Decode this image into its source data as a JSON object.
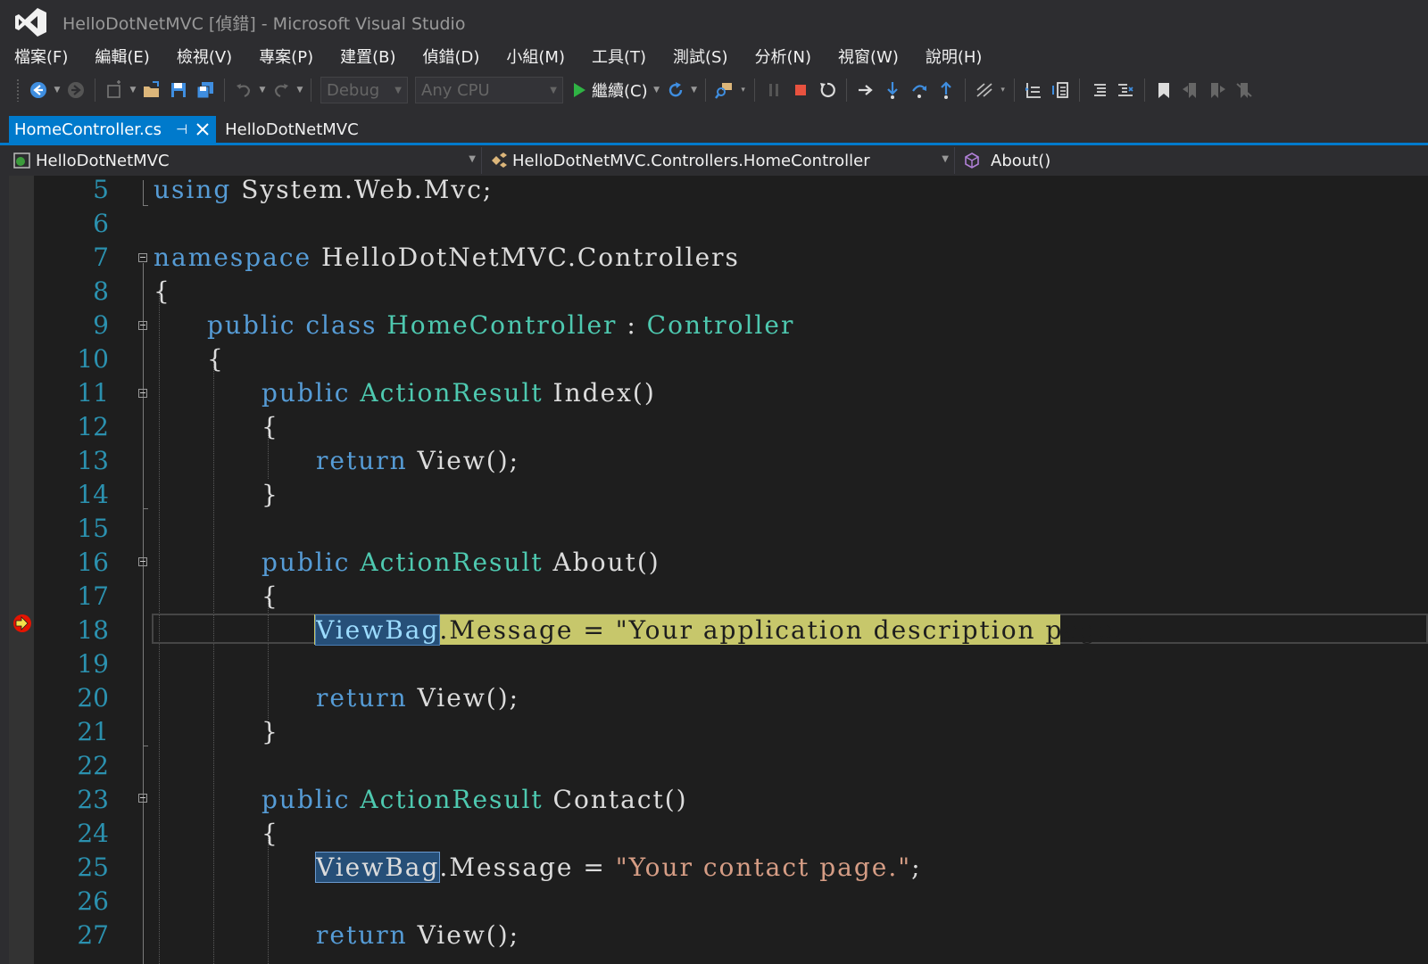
{
  "window": {
    "title": "HelloDotNetMVC [偵錯] - Microsoft Visual Studio"
  },
  "menu": {
    "items": [
      "檔案(F)",
      "編輯(E)",
      "檢視(V)",
      "專案(P)",
      "建置(B)",
      "偵錯(D)",
      "小組(M)",
      "工具(T)",
      "測試(S)",
      "分析(N)",
      "視窗(W)",
      "說明(H)"
    ]
  },
  "toolbar": {
    "configuration": "Debug",
    "platform": "Any CPU",
    "continue_label": "繼續(C)",
    "icons": [
      "back-icon",
      "forward-icon",
      "new-project-icon",
      "open-file-icon",
      "save-icon",
      "save-all-icon",
      "undo-icon",
      "redo-icon",
      "play-icon",
      "refresh-icon",
      "find-icon",
      "pause-icon",
      "stop-icon",
      "restart-icon",
      "show-next-statement-icon",
      "step-into-icon",
      "step-over-icon",
      "step-out-icon",
      "hot-reload-icon",
      "bookmark-icon"
    ]
  },
  "tabs": {
    "active": "HomeController.cs",
    "inactive": "HelloDotNetMVC"
  },
  "navbar": {
    "project": "HelloDotNetMVC",
    "class": "HelloDotNetMVC.Controllers.HomeController",
    "member": "About()"
  },
  "editor": {
    "line_numbers": [
      "5",
      "6",
      "7",
      "8",
      "9",
      "10",
      "11",
      "12",
      "13",
      "14",
      "15",
      "16",
      "17",
      "18",
      "19",
      "20",
      "21",
      "22",
      "23",
      "24",
      "25",
      "26",
      "27"
    ],
    "current_line": "18",
    "lines": {
      "l5_kw": "using",
      "l5_rest": " System.Web.Mvc;",
      "l7_kw": "namespace",
      "l7_rest": " HelloDotNetMVC.Controllers",
      "l8": "{",
      "l9_kw": "public class",
      "l9_type1": "HomeController",
      "l9_sep": " : ",
      "l9_type2": "Controller",
      "l10": "{",
      "l11_kw": "public",
      "l11_type": "ActionResult",
      "l11_rest": " Index()",
      "l12": "{",
      "l13_kw": "return",
      "l13_rest": " View();",
      "l14": "}",
      "l16_kw": "public",
      "l16_type": "ActionResult",
      "l16_rest": " About()",
      "l17": "{",
      "l18_viewbag": "ViewBag",
      "l18_rest": ".Message = \"Your application description page.\";",
      "l20_kw": "return",
      "l20_rest": " View();",
      "l21": "}",
      "l23_kw": "public",
      "l23_type": "ActionResult",
      "l23_rest": " Contact()",
      "l24": "{",
      "l25_viewbag": "ViewBag",
      "l25_mid": ".Message = ",
      "l25_str": "\"Your contact page.\"",
      "l25_end": ";",
      "l27_kw": "return",
      "l27_rest": " View();"
    }
  },
  "colors": {
    "keyword": "#569cd6",
    "type": "#4ec9b0",
    "string": "#d69d85",
    "line_number": "#2b91af",
    "accent": "#007acc",
    "current_statement": "#c7c76b"
  }
}
